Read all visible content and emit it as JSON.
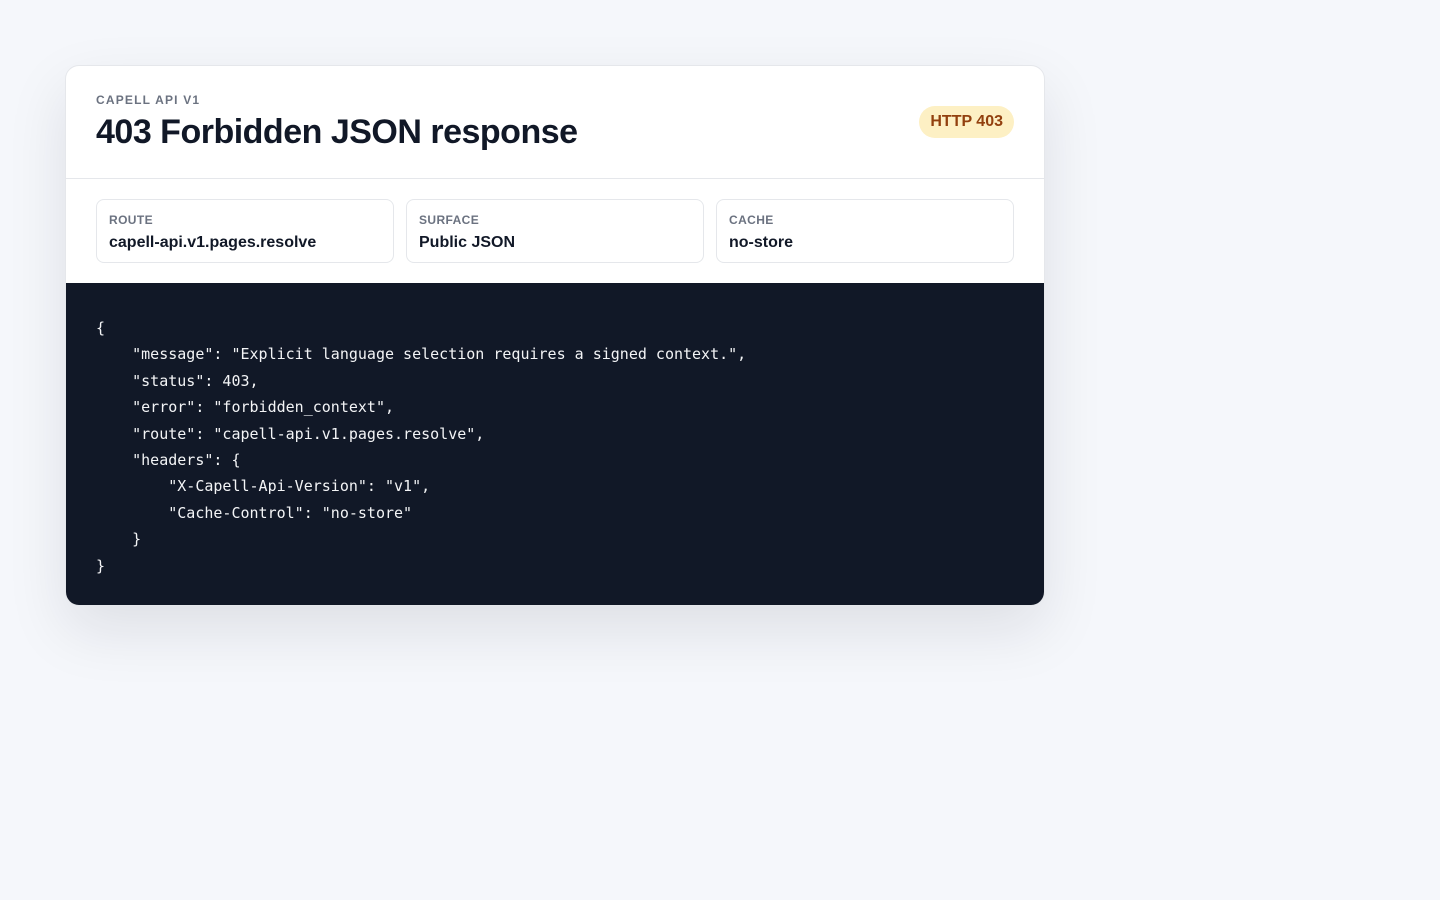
{
  "header": {
    "eyebrow": "CAPELL API V1",
    "title": "403 Forbidden JSON response",
    "status_badge": "HTTP 403"
  },
  "meta": [
    {
      "label": "ROUTE",
      "value": "capell-api.v1.pages.resolve"
    },
    {
      "label": "SURFACE",
      "value": "Public JSON"
    },
    {
      "label": "CACHE",
      "value": "no-store"
    }
  ],
  "code": {
    "lines": [
      "{",
      "    \"message\": \"Explicit language selection requires a signed context.\",",
      "    \"status\": 403,",
      "    \"error\": \"forbidden_context\",",
      "    \"route\": \"capell-api.v1.pages.resolve\",",
      "    \"headers\": {",
      "        \"X-Capell-Api-Version\": \"v1\",",
      "        \"Cache-Control\": \"no-store\"",
      "    }",
      "}"
    ]
  },
  "colors": {
    "page_background": "#f5f7fb",
    "code_background": "#111827",
    "badge_background": "#fdf0c4",
    "badge_text": "#92400e"
  }
}
